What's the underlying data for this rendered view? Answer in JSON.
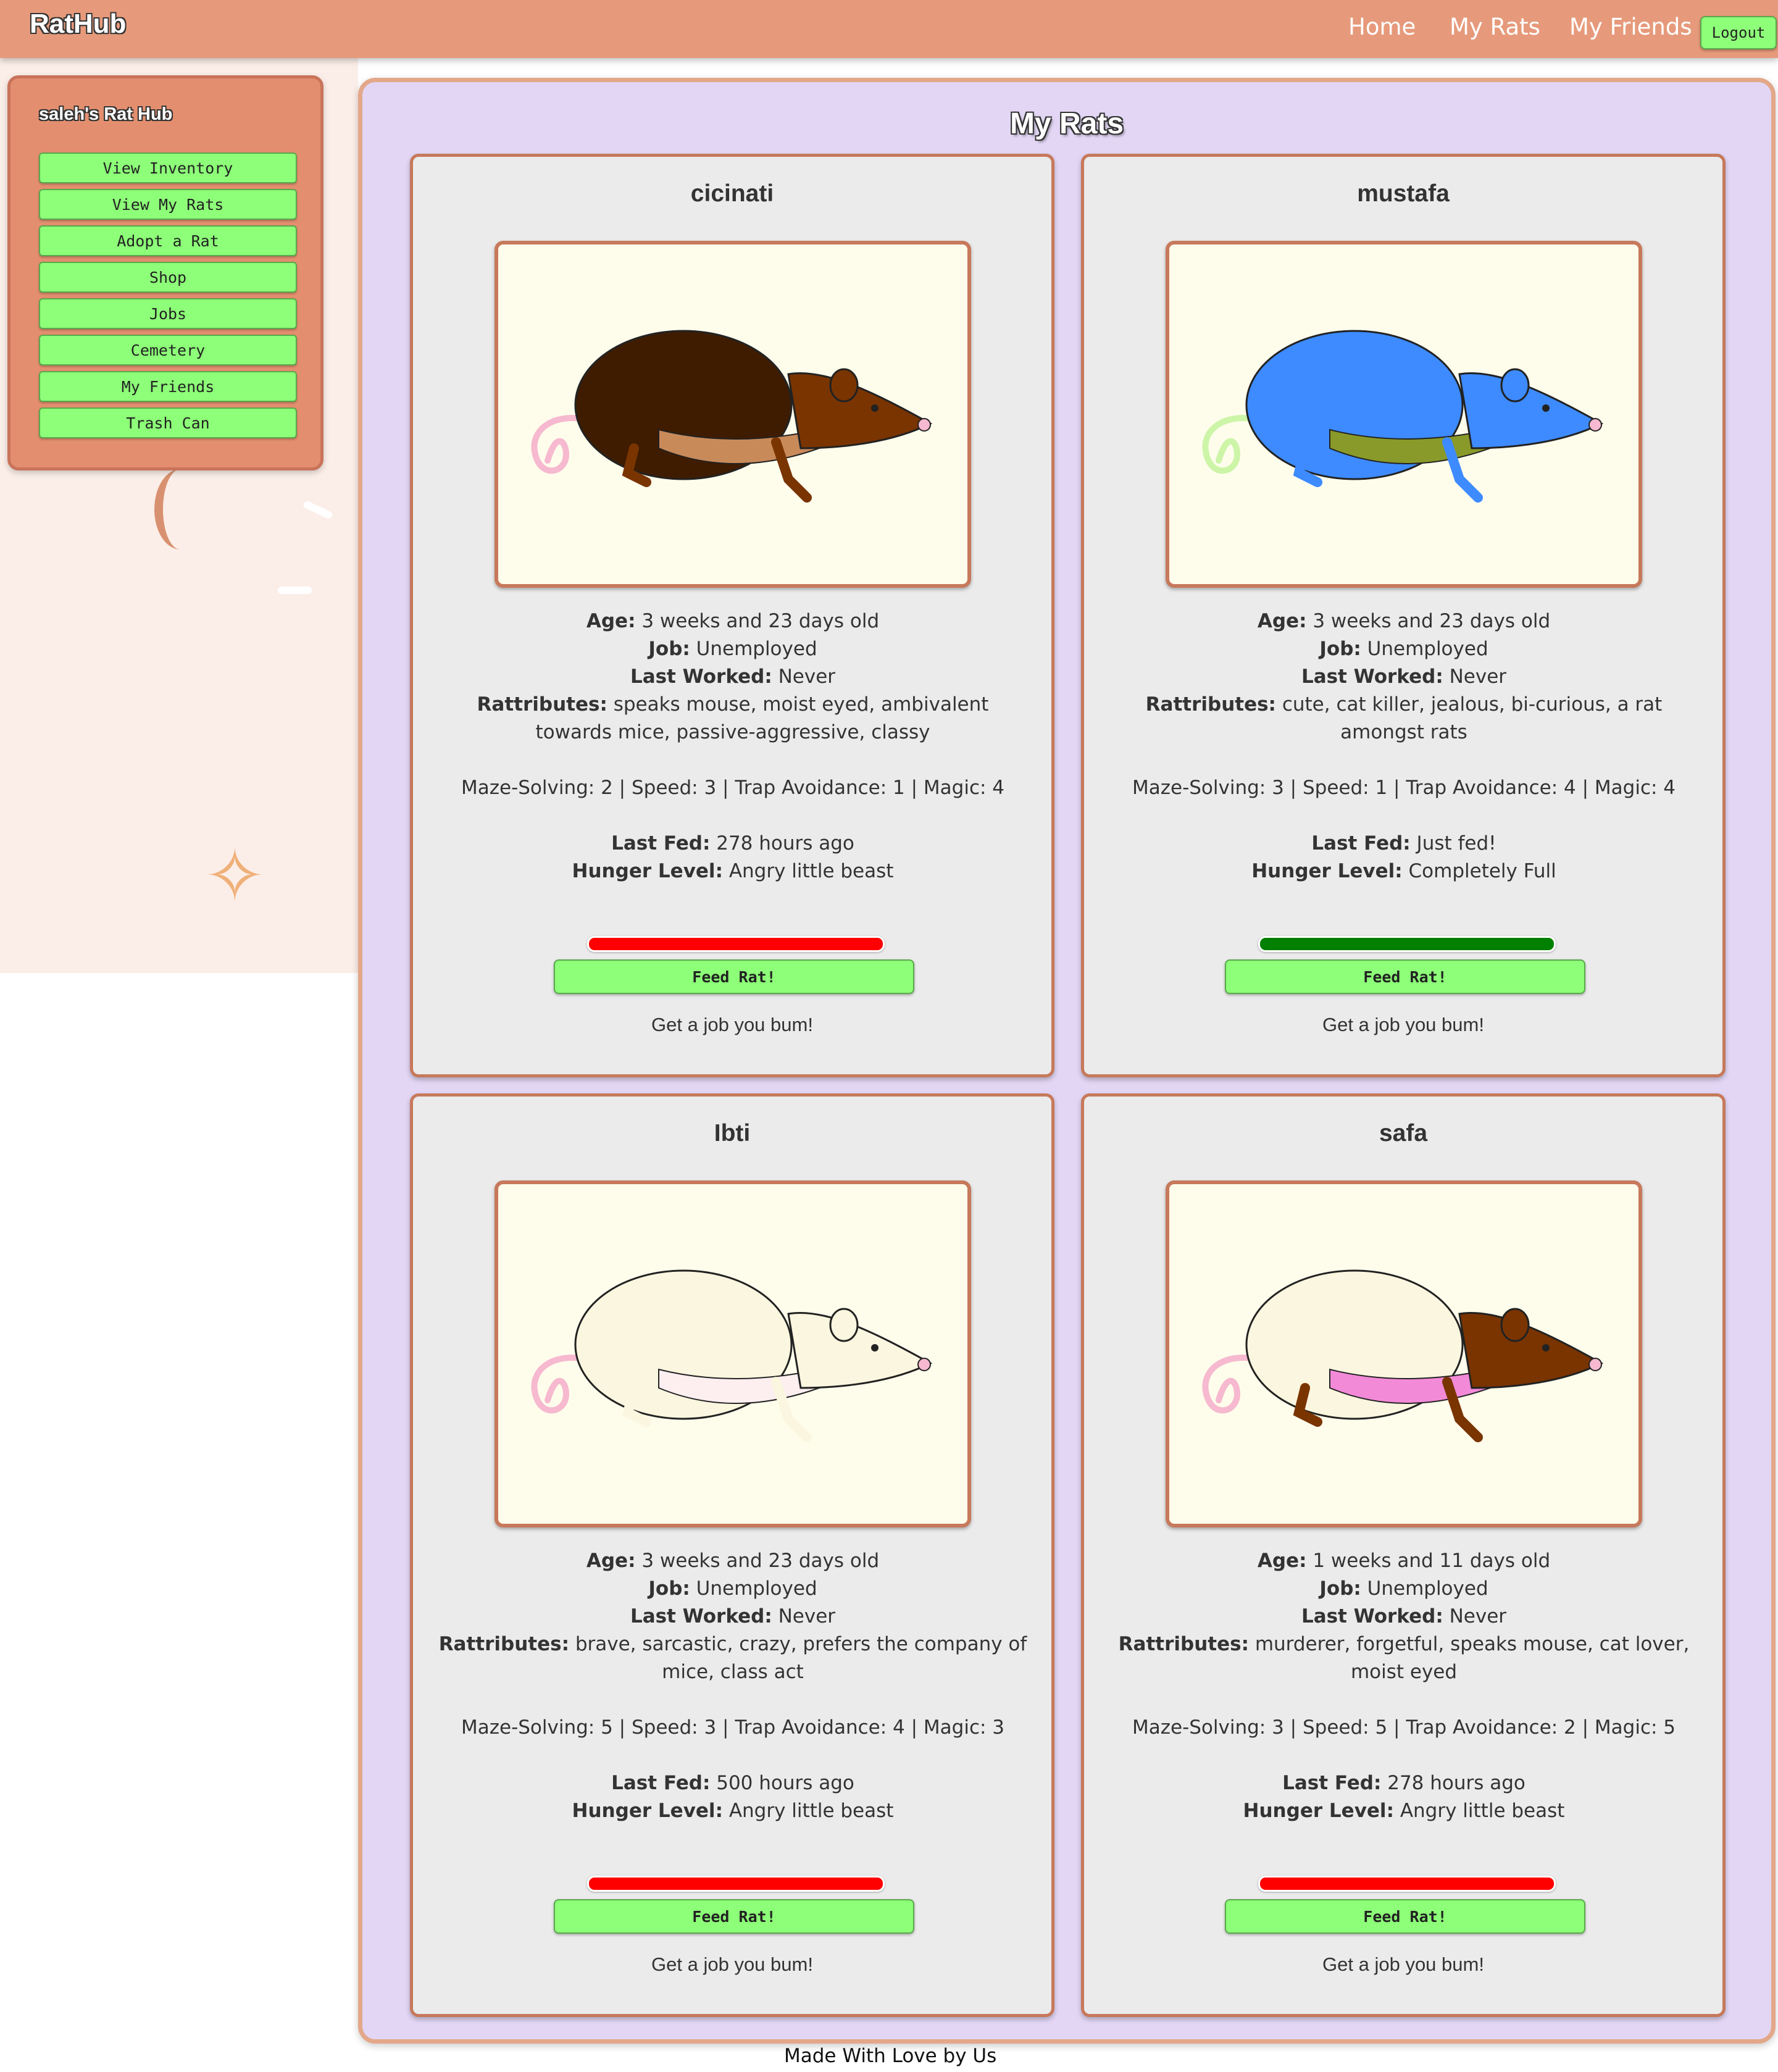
{
  "header": {
    "brand": "RatHub",
    "nav": {
      "home": "Home",
      "my_rats": "My Rats",
      "my_friends": "My Friends"
    },
    "logout": "Logout"
  },
  "sidebar": {
    "title": "saleh's Rat Hub",
    "items": [
      {
        "label": "View Inventory"
      },
      {
        "label": "View My Rats"
      },
      {
        "label": "Adopt a Rat"
      },
      {
        "label": "Shop"
      },
      {
        "label": "Jobs"
      },
      {
        "label": "Cemetery"
      },
      {
        "label": "My Friends"
      },
      {
        "label": "Trash Can"
      }
    ]
  },
  "main": {
    "title": "My Rats",
    "labels": {
      "age": "Age:",
      "job": "Job:",
      "last_worked": "Last Worked:",
      "rattributes": "Rattributes:",
      "last_fed": "Last Fed:",
      "hunger": "Hunger Level:"
    },
    "rats": [
      {
        "name": "cicinati",
        "age": "3 weeks and 23 days old",
        "job": "Unemployed",
        "last_worked": "Never",
        "rattributes": "speaks mouse, moist eyed, ambivalent towards mice, passive-aggressive, classy",
        "stats": "Maze-Solving: 2 | Speed: 3 | Trap Avoidance: 1 | Magic: 4",
        "last_fed": "278 hours ago",
        "hunger": "Angry little beast",
        "hunger_color": "#ff0000",
        "feed_label": "Feed Rat!",
        "job_msg": "Get a job you bum!",
        "look": {
          "body": "#3f1c00",
          "head": "#7a3400",
          "belly": "#c98a5a",
          "outline": "#222",
          "tail": "#f6b9cf"
        }
      },
      {
        "name": "mustafa",
        "age": "3 weeks and 23 days old",
        "job": "Unemployed",
        "last_worked": "Never",
        "rattributes": "cute, cat killer, jealous, bi-curious, a rat amongst rats",
        "stats": "Maze-Solving: 3 | Speed: 1 | Trap Avoidance: 4 | Magic: 4",
        "last_fed": "Just fed!",
        "hunger": "Completely Full",
        "hunger_color": "#008000",
        "feed_label": "Feed Rat!",
        "job_msg": "Get a job you bum!",
        "look": {
          "body": "#3d8bff",
          "head": "#3d8bff",
          "belly": "#8a9a2a",
          "outline": "#222",
          "tail": "#cdf5a8"
        }
      },
      {
        "name": "Ibti",
        "age": "3 weeks and 23 days old",
        "job": "Unemployed",
        "last_worked": "Never",
        "rattributes": "brave, sarcastic, crazy, prefers the company of mice, class act",
        "stats": "Maze-Solving: 5 | Speed: 3 | Trap Avoidance: 4 | Magic: 3",
        "last_fed": "500 hours ago",
        "hunger": "Angry little beast",
        "hunger_color": "#ff0000",
        "feed_label": "Feed Rat!",
        "job_msg": "Get a job you bum!",
        "look": {
          "body": "#fbf6df",
          "head": "#fbf6df",
          "belly": "#fdeef0",
          "outline": "#222",
          "tail": "#f6b9cf"
        }
      },
      {
        "name": "safa",
        "age": "1 weeks and 11 days old",
        "job": "Unemployed",
        "last_worked": "Never",
        "rattributes": "murderer, forgetful, speaks mouse, cat lover, moist eyed",
        "stats": "Maze-Solving: 3 | Speed: 5 | Trap Avoidance: 2 | Magic: 5",
        "last_fed": "278 hours ago",
        "hunger": "Angry little beast",
        "hunger_color": "#ff0000",
        "feed_label": "Feed Rat!",
        "job_msg": "Get a job you bum!",
        "look": {
          "body": "#fbf6df",
          "head": "#7a3400",
          "belly": "#f28ad8",
          "outline": "#222",
          "tail": "#f6b9cf"
        }
      }
    ]
  },
  "footer": "Made With Love by Us"
}
